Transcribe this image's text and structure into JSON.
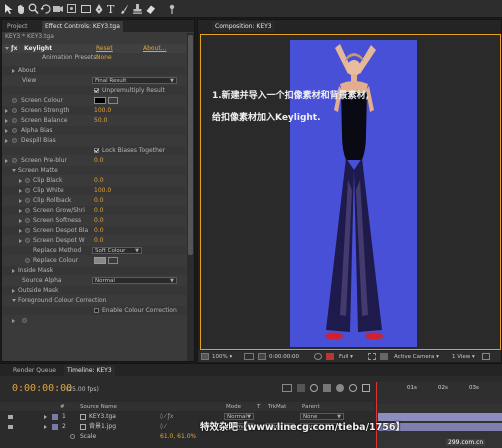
{
  "toolbar": {
    "tools": [
      "selection-tool",
      "hand-tool",
      "zoom-tool",
      "rotation-tool",
      "camera-tool",
      "pan-behind-tool",
      "mask-tool",
      "pen-tool",
      "text-tool",
      "brush-tool",
      "clone-tool",
      "eraser-tool"
    ]
  },
  "effects_panel": {
    "tabs": [
      "Project",
      "Effect Controls: KEY3.tga"
    ],
    "breadcrumb": "KEY3 * KEY3.tga",
    "effect_name": "Keylight",
    "reset_label": "Reset",
    "about_label": "About...",
    "presets_label": "Animation Presets:",
    "presets_value": "None",
    "rows": [
      {
        "label": "About"
      },
      {
        "label": "View",
        "value": "Final Result"
      },
      {
        "label": "Unpremultiply Result"
      },
      {
        "label": "Screen Colour"
      },
      {
        "label": "Screen Strength",
        "value": "100.0"
      },
      {
        "label": "Screen Balance",
        "value": "50.0"
      },
      {
        "label": "Alpha Bias",
        "value": ""
      },
      {
        "label": "Despill Bias",
        "value": ""
      },
      {
        "label": "Lock Biases Together"
      },
      {
        "label": "Screen Pre-blur",
        "value": "0.0"
      },
      {
        "label": "Screen Matte"
      },
      {
        "label": "Clip Black",
        "value": "0.0"
      },
      {
        "label": "Clip White",
        "value": "100.0"
      },
      {
        "label": "Clip Rollback",
        "value": "0.0"
      },
      {
        "label": "Screen Grow/Shri",
        "value": "0.0"
      },
      {
        "label": "Screen Softness",
        "value": "0.0"
      },
      {
        "label": "Screen Despot Bla",
        "value": "0.0"
      },
      {
        "label": "Screen Despot W",
        "value": "0.0"
      },
      {
        "label": "Replace Method",
        "value": "Soft Colour"
      },
      {
        "label": "Replace Colour"
      },
      {
        "label": "Inside Mask"
      },
      {
        "label": "Source Alpha",
        "value": "Normal"
      },
      {
        "label": "Outside Mask"
      },
      {
        "label": "Foreground Colour Correction"
      },
      {
        "label": "Enable Colour Correction"
      }
    ]
  },
  "composition": {
    "tab": "Composition: KEY3",
    "notes": [
      "1.新建并导入一个扣像素材和背景素材,",
      "给扣像素材加入Keylight."
    ],
    "canvas_color": "#4850d8",
    "viewer_bar": {
      "zoom": "100%",
      "timecode": "0:00:00:00",
      "resolution": "Full",
      "view": "Active Camera",
      "views": "1 View"
    }
  },
  "timeline": {
    "tabs": [
      "Render Queue",
      "Timeline: KEY3"
    ],
    "timecode": "0:00:00:00",
    "fps": "(25.00 fps)",
    "headers": [
      "#",
      "Source Name",
      "Mode",
      "T",
      "TrkMat",
      "Parent"
    ],
    "ruler_ticks": [
      "01s",
      "02s",
      "03s"
    ],
    "layers": [
      {
        "num": "1",
        "name": "KEY3.tga",
        "mode": "Normal",
        "trkmat": "",
        "parent": "None"
      },
      {
        "num": "2",
        "name": "背景1.jpg",
        "mode": "Normal",
        "trkmat": "None",
        "parent": "None"
      }
    ],
    "scale_label": "Scale",
    "scale_value": "61.0, 61.0%"
  },
  "watermark": "特效杂吧【www.linecg.com/tieba/1756】",
  "corner_logo": "299.com.cn"
}
